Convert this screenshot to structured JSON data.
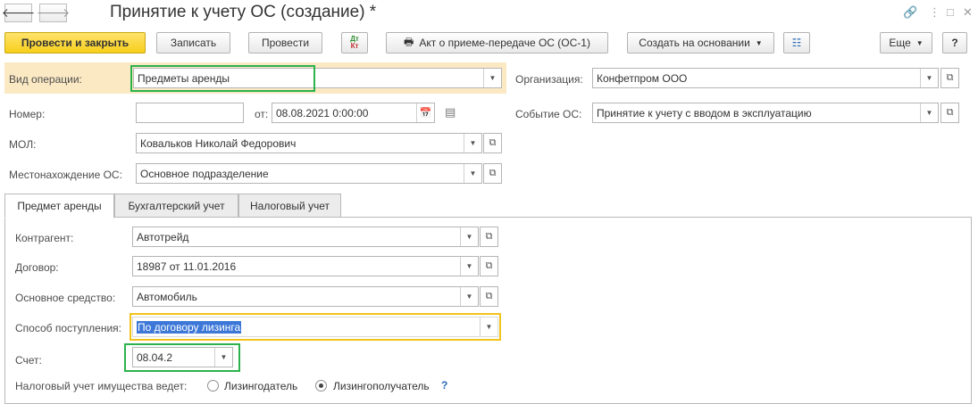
{
  "window": {
    "title": "Принятие к учету ОС (создание) *",
    "icons": {
      "back": "arrow-left-icon",
      "forward": "arrow-right-icon",
      "more": "more-vertical-icon",
      "link": "link-icon",
      "maximize": "maximize-icon",
      "close": "close-icon"
    }
  },
  "toolbar": {
    "post_close": "Провести и закрыть",
    "save": "Записать",
    "post": "Провести",
    "dt_kt_top": "Дт",
    "dt_kt_bottom": "Кт",
    "print_act": "Акт о приеме-передаче ОС (ОС-1)",
    "create_based": "Создать на основании",
    "more": "Еще",
    "help": "?"
  },
  "header": {
    "operation_label": "Вид операции:",
    "operation_value": "Предметы аренды",
    "organization_label": "Организация:",
    "organization_value": "Конфетпром ООО",
    "number_label": "Номер:",
    "number_value": "",
    "date_label": "от:",
    "date_value": "08.08.2021  0:00:00",
    "event_label": "Событие ОС:",
    "event_value": "Принятие к учету с вводом в эксплуатацию",
    "mol_label": "МОЛ:",
    "mol_value": "Ковальков Николай Федорович",
    "location_label": "Местонахождение ОС:",
    "location_value": "Основное подразделение"
  },
  "tabs": [
    {
      "label": "Предмет аренды",
      "active": true
    },
    {
      "label": "Бухгалтерский учет",
      "active": false
    },
    {
      "label": "Налоговый учет",
      "active": false
    }
  ],
  "lease": {
    "counterparty_label": "Контрагент:",
    "counterparty_value": "Автотрейд",
    "contract_label": "Договор:",
    "contract_value": "18987 от 11.01.2016",
    "asset_label": "Основное средство:",
    "asset_value": "Автомобиль",
    "receipt_label": "Способ поступления:",
    "receipt_value": "По договору лизинга",
    "account_label": "Счет:",
    "account_value": "08.04.2",
    "tax_label": "Налоговый учет имущества ведет:",
    "tax_option_lessor": "Лизингодатель",
    "tax_option_lessee": "Лизингополучатель",
    "tax_selected": "Лизингополучатель",
    "tax_help": "?"
  },
  "colors": {
    "primary_button": "#f7cf1b",
    "highlight_green": "#2bb24c",
    "highlight_yellow": "#f2c31a",
    "operation_bg": "#fbe9c4",
    "selection": "#3d78d8",
    "help_link": "#2a6bb5"
  }
}
